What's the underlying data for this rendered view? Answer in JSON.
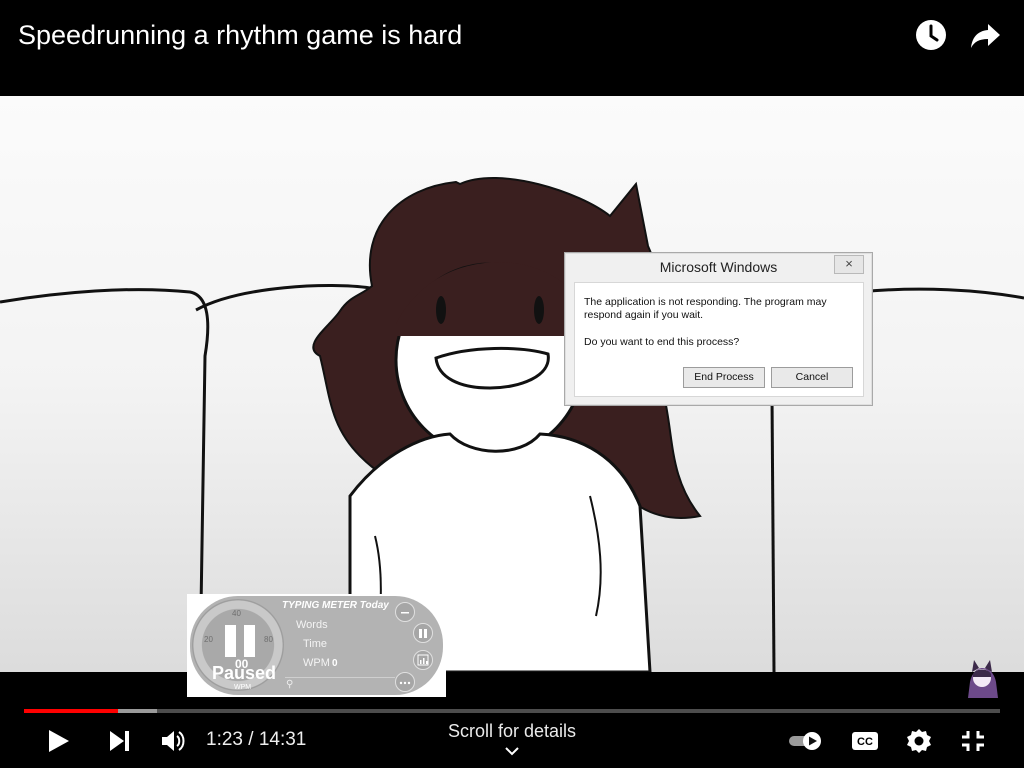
{
  "header": {
    "title": "Speedrunning a rhythm game is hard",
    "icons": [
      "clock-icon",
      "share-icon"
    ]
  },
  "dialog": {
    "title": "Microsoft Windows",
    "close_label": "×",
    "message": "The application is not responding. The program may respond again if you wait.",
    "question": "Do you want to end this process?",
    "end_label": "End Process",
    "cancel_label": "Cancel"
  },
  "typing_meter": {
    "brand": "TYPING METER Today",
    "ticks": [
      "20",
      "40",
      "80"
    ],
    "value": "00",
    "status": "Paused",
    "unit": "WPM",
    "labels": {
      "words": "Words",
      "time": "Time",
      "wpm": "WPM"
    },
    "wpm_value": "0"
  },
  "player": {
    "current_time": "1:23",
    "duration": "14:31",
    "time_display": "1:23 / 14:31",
    "played_fraction": 0.096,
    "buffered_fraction": 0.136,
    "scroll_hint": "Scroll for details",
    "icons": [
      "play-icon",
      "next-icon",
      "volume-icon",
      "autoplay-toggle-icon",
      "captions-icon",
      "settings-icon",
      "exit-fullscreen-icon"
    ],
    "colors": {
      "played": "#ff0000",
      "buffer": "#9a9a9a",
      "track": "#4d4d4d"
    }
  }
}
